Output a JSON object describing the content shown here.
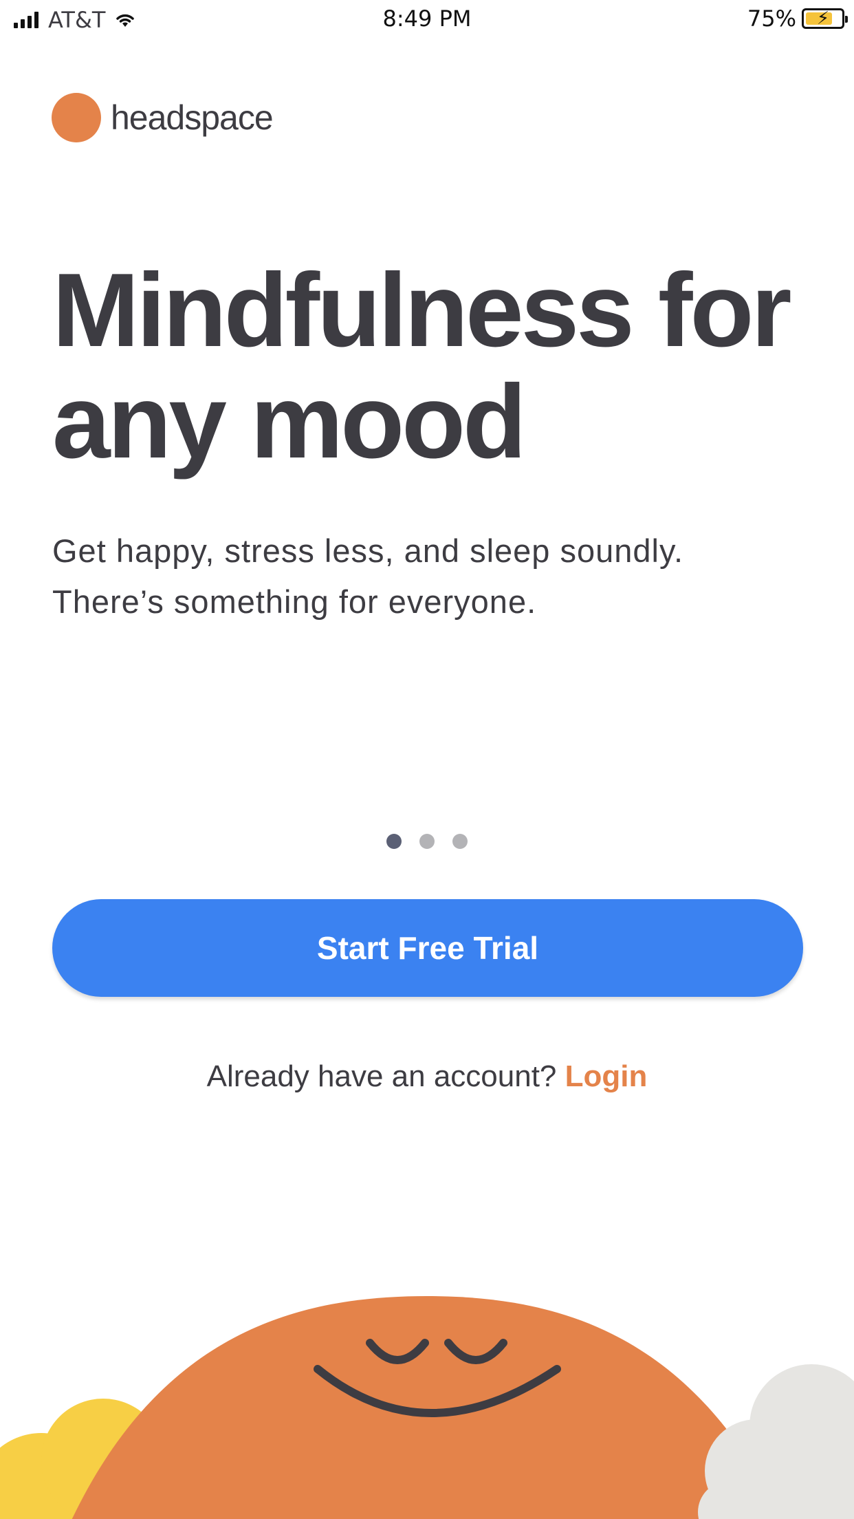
{
  "status_bar": {
    "carrier": "AT&T",
    "time": "8:49 PM",
    "battery_percent": "75%",
    "battery_level": 0.75
  },
  "brand": {
    "name": "headspace"
  },
  "hero": {
    "headline_line1": "Mindfulness for",
    "headline_line2": "any mood",
    "subtitle_line1": "Get happy, stress less, and sleep soundly.",
    "subtitle_line2": "There’s something for everyone."
  },
  "carousel": {
    "page_count": 3,
    "active_index": 0
  },
  "cta": {
    "label": "Start Free Trial"
  },
  "account": {
    "prompt": "Already have an account?",
    "login_label": "Login"
  },
  "colors": {
    "brand_orange": "#e4834a",
    "primary_blue": "#3b82f1",
    "text_dark": "#3d3c42",
    "sun_yellow": "#f7cf45",
    "cloud_gray": "#e6e5e2"
  }
}
